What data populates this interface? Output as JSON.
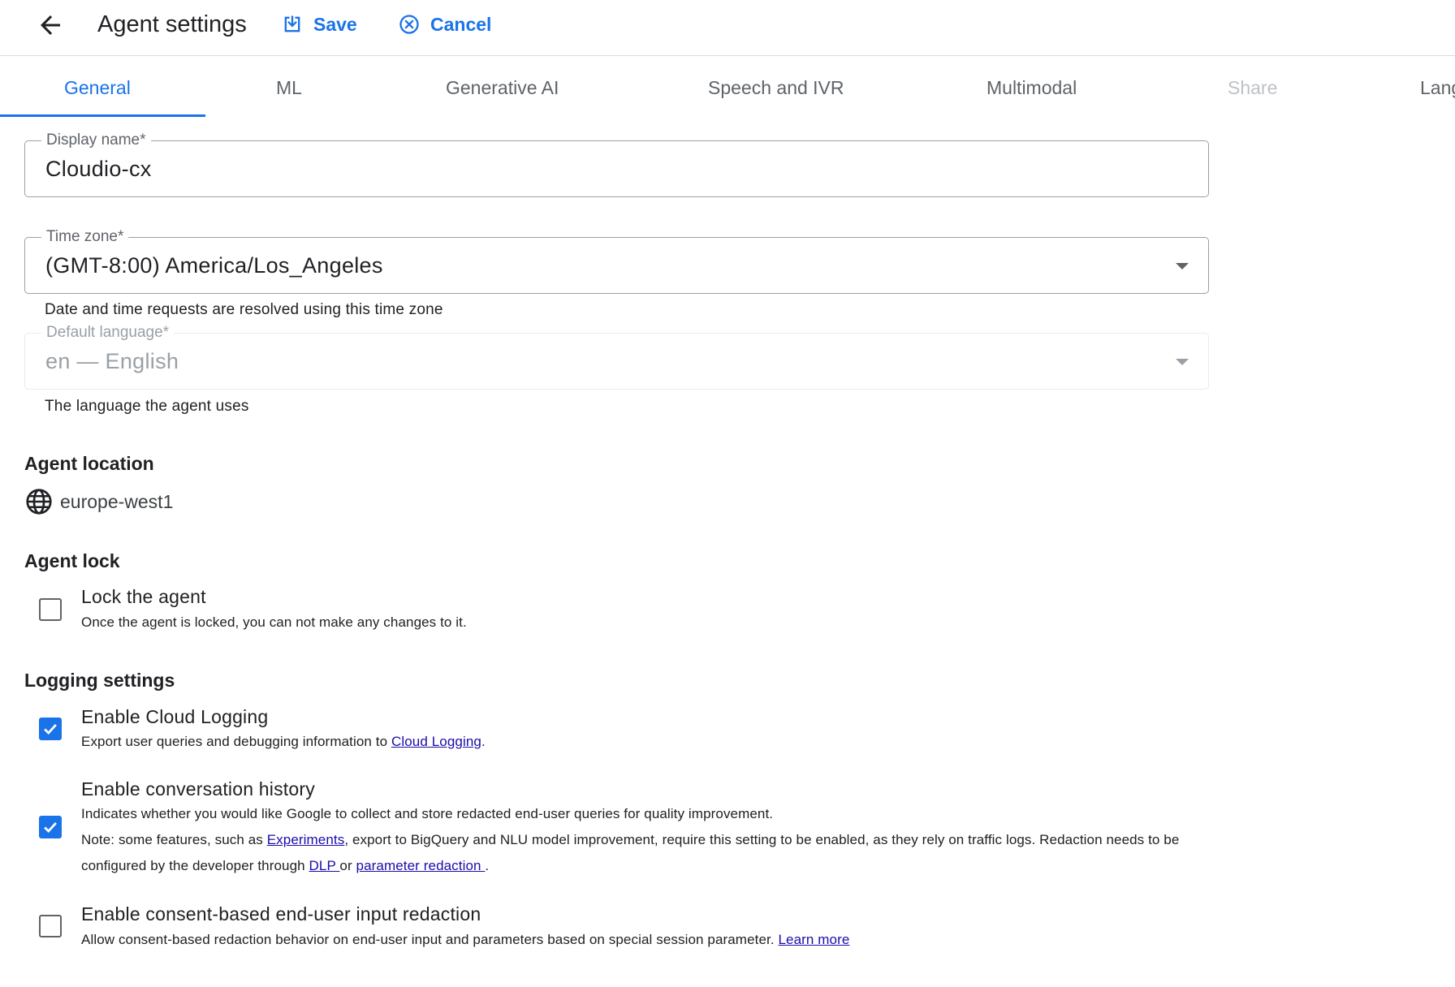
{
  "header": {
    "title": "Agent settings",
    "back_icon": "arrow-back-icon",
    "save_label": "Save",
    "save_icon": "save-icon",
    "cancel_label": "Cancel",
    "cancel_icon": "cancel-circle-icon",
    "accent_color": "#1a73e8"
  },
  "tabs": [
    {
      "label": "General",
      "state": "active"
    },
    {
      "label": "ML",
      "state": "normal"
    },
    {
      "label": "Generative AI",
      "state": "normal"
    },
    {
      "label": "Speech and IVR",
      "state": "normal"
    },
    {
      "label": "Multimodal",
      "state": "normal"
    },
    {
      "label": "Share",
      "state": "disabled"
    },
    {
      "label": "Lang",
      "state": "normal"
    }
  ],
  "form": {
    "display_name": {
      "label": "Display name*",
      "value": "Cloudio-cx"
    },
    "time_zone": {
      "label": "Time zone*",
      "value": "(GMT-8:00) America/Los_Angeles",
      "hint": "Date and time requests are resolved using this time zone"
    },
    "default_language": {
      "label": "Default language*",
      "value": "en — English",
      "hint": "The language the agent uses",
      "disabled": true
    }
  },
  "agent_location": {
    "title": "Agent location",
    "icon": "globe-icon",
    "value": "europe-west1"
  },
  "agent_lock": {
    "title": "Agent lock",
    "lock": {
      "checked": false,
      "label": "Lock the agent",
      "description": "Once the agent is locked, you can not make any changes to it."
    }
  },
  "logging": {
    "title": "Logging settings",
    "cloud_logging": {
      "checked": true,
      "label": "Enable Cloud Logging",
      "desc_pre": "Export user queries and debugging information to ",
      "desc_link": "Cloud Logging",
      "desc_post": "."
    },
    "conversation_history": {
      "checked": true,
      "label": "Enable conversation history",
      "desc1": "Indicates whether you would like Google to collect and store redacted end-user queries for quality improvement.",
      "note_pre": "Note: some features, such as ",
      "note_link1": "Experiments",
      "note_mid": ", export to BigQuery and NLU model improvement, require this setting to be enabled, as they rely on traffic logs. Redaction needs to be",
      "note2_pre": "configured by the developer through ",
      "note2_link1": "DLP ",
      "note2_mid": "or ",
      "note2_link2": "parameter redaction ",
      "note2_post": "."
    },
    "consent_redaction": {
      "checked": false,
      "label": "Enable consent-based end-user input redaction",
      "desc_pre": "Allow consent-based redaction behavior on end-user input and parameters based on special session parameter. ",
      "desc_link": "Learn more"
    }
  }
}
